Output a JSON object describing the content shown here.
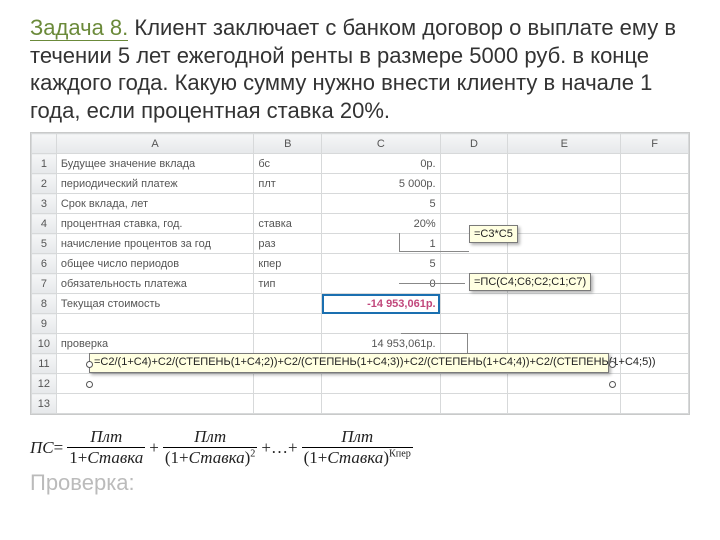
{
  "title": {
    "task": "Задача 8.",
    "text": " Клиент заключает с банком договор о выплате ему в течении 5 лет ежегодной ренты в размере 5000 руб. в конце каждого года. Какую сумму нужно внести клиенту в начале 1 года, если процентная ставка 20%."
  },
  "columns": [
    "",
    "A",
    "B",
    "C",
    "D",
    "E",
    "F"
  ],
  "rows": [
    {
      "n": "1",
      "a": "Будущее значение вклада",
      "b": "бс",
      "c": "0р."
    },
    {
      "n": "2",
      "a": "периодический платеж",
      "b": "плт",
      "c": "5 000р."
    },
    {
      "n": "3",
      "a": "Срок вклада, лет",
      "b": "",
      "c": "5"
    },
    {
      "n": "4",
      "a": "процентная ставка, год.",
      "b": "ставка",
      "c": "20%"
    },
    {
      "n": "5",
      "a": "начисление процентов за год",
      "b": "раз",
      "c": "1"
    },
    {
      "n": "6",
      "a": "общее число периодов",
      "b": "кпер",
      "c": "5"
    },
    {
      "n": "7",
      "a": "обязательность платежа",
      "b": "тип",
      "c": "0"
    },
    {
      "n": "8",
      "a": "Текущая стоимость",
      "b": "",
      "c": "-14 953,061р."
    },
    {
      "n": "9",
      "a": "",
      "b": "",
      "c": ""
    },
    {
      "n": "10",
      "a": "проверка",
      "b": "",
      "c": "14 953,061р."
    },
    {
      "n": "11",
      "a": "",
      "b": "",
      "c": ""
    },
    {
      "n": "12",
      "a": "",
      "b": "",
      "c": ""
    },
    {
      "n": "13",
      "a": "",
      "b": "",
      "c": ""
    }
  ],
  "callouts": {
    "c5": "=C3*C5",
    "c7": "=ПС(C4;C6;C2;C1;C7)",
    "big": "=C2/(1+C4)+C2/(СТЕПЕНЬ(1+C4;2))+C2/(СТЕПЕНЬ(1+C4;3))+C2/(СТЕПЕНЬ(1+C4;4))+C2/(СТЕПЕНЬ(1+C4;5))"
  },
  "formula": {
    "lhs": "ПС",
    "eq": " = ",
    "num": "Плт",
    "d1a": "1+",
    "d1b": "Ставка",
    "plus": " + ",
    "d2a": "(1+",
    "d2b": "Ставка",
    "d2c": ")",
    "exp2": "2",
    "dots": " +…+ ",
    "dna": "(1+",
    "dnb": "Ставка",
    "dnc": ")",
    "expn": "Кпер"
  },
  "overlay": "Проверка:"
}
